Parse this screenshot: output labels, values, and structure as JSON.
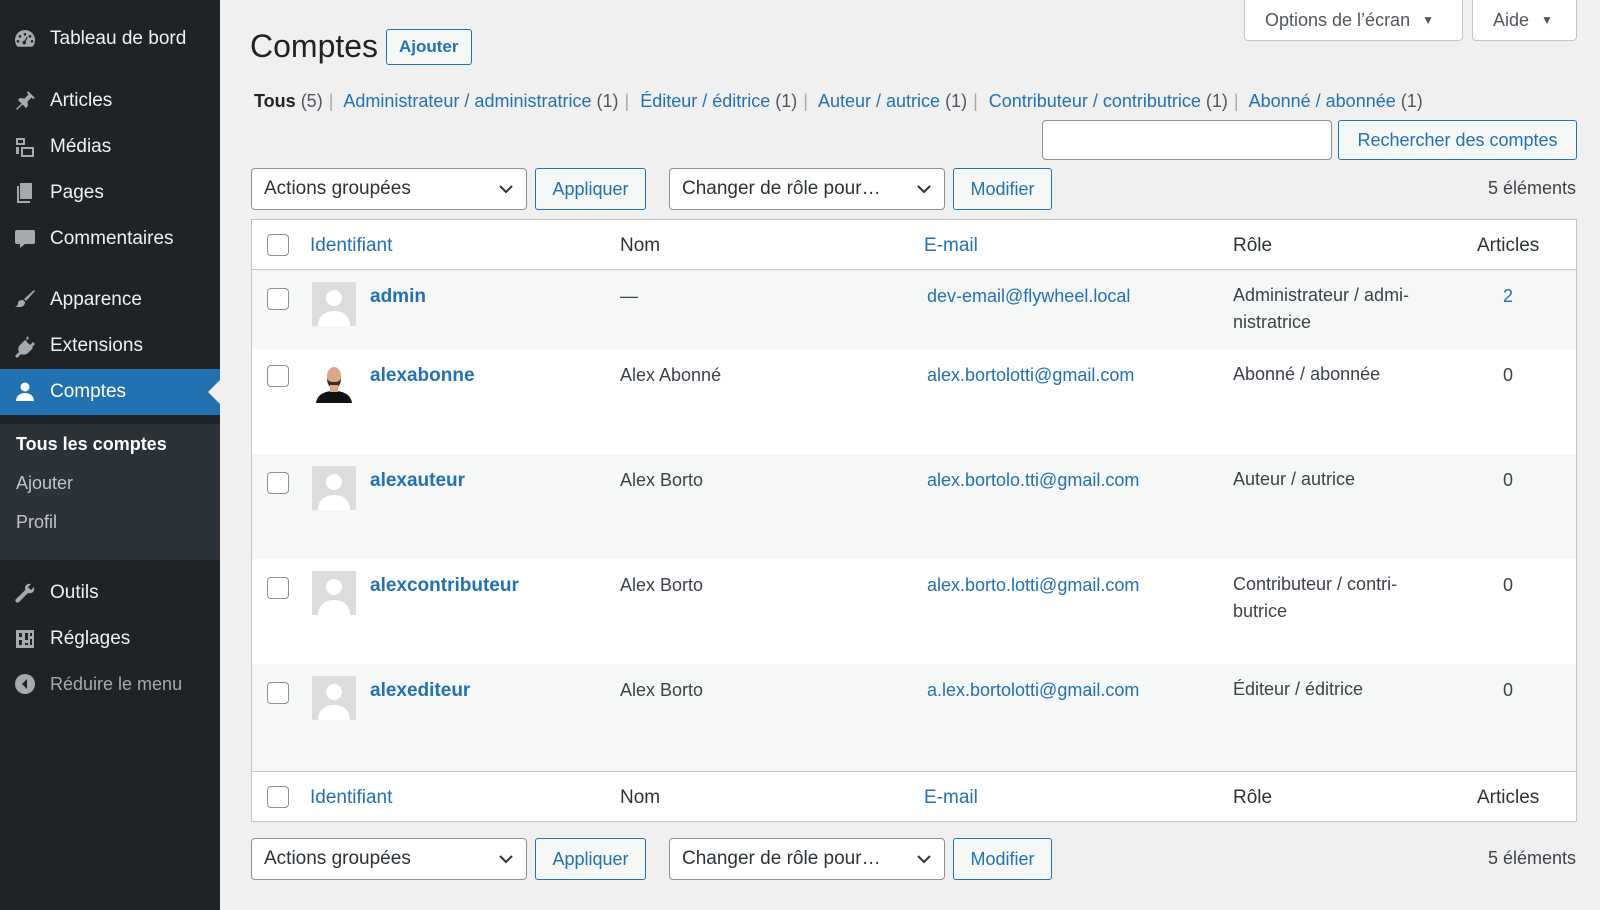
{
  "sidebar": {
    "items": [
      {
        "label": "Tableau de bord",
        "icon": "dashboard-icon"
      },
      {
        "label": "Articles",
        "icon": "pin-icon"
      },
      {
        "label": "Médias",
        "icon": "media-icon"
      },
      {
        "label": "Pages",
        "icon": "pages-icon"
      },
      {
        "label": "Commentaires",
        "icon": "comments-icon"
      },
      {
        "label": "Apparence",
        "icon": "appearance-brush-icon"
      },
      {
        "label": "Extensions",
        "icon": "plugins-icon"
      },
      {
        "label": "Comptes",
        "icon": "users-icon"
      },
      {
        "label": "Outils",
        "icon": "tools-wrench-icon"
      },
      {
        "label": "Réglages",
        "icon": "settings-sliders-icon"
      }
    ],
    "submenu": [
      "Tous les comptes",
      "Ajouter",
      "Profil"
    ],
    "collapse_label": "Réduire le menu"
  },
  "screen_options": {
    "label": "Options de l’écran",
    "help_label": "Aide"
  },
  "header": {
    "title": "Comptes",
    "add_label": "Ajouter"
  },
  "filters": [
    {
      "label": "Tous",
      "count": "(5)"
    },
    {
      "label": "Administrateur / administratrice",
      "count": "(1)"
    },
    {
      "label": "Éditeur / éditrice",
      "count": "(1)"
    },
    {
      "label": "Auteur / autrice",
      "count": "(1)"
    },
    {
      "label": "Contributeur / contributrice",
      "count": "(1)"
    },
    {
      "label": "Abonné / abonnée",
      "count": "(1)"
    }
  ],
  "search": {
    "value": "",
    "button_label": "Rechercher des comptes"
  },
  "tablenav": {
    "bulk_actions": "Actions groupées",
    "apply_label": "Appliquer",
    "change_role": "Changer de rôle pour…",
    "modify_label": "Modifier",
    "count": "5 éléments"
  },
  "table": {
    "columns": {
      "username": "Identifiant",
      "name": "Nom",
      "email": "E-mail",
      "role": "Rôle",
      "posts": "Articles"
    },
    "rows": [
      {
        "username": "admin",
        "name": "—",
        "email": "dev-email@flywheel.local",
        "role": "Administrateur / admi-nistratrice",
        "posts": "2",
        "avatar": "default"
      },
      {
        "username": "alexabonne",
        "name": "Alex Abonné",
        "email": "alex.bortolotti@gmail.com",
        "role": "Abonné / abonnée",
        "posts": "0",
        "avatar": "photo"
      },
      {
        "username": "alexauteur",
        "name": "Alex Borto",
        "email": "alex.bortolo.tti@gmail.com",
        "role": "Auteur / autrice",
        "posts": "0",
        "avatar": "default"
      },
      {
        "username": "alexcontributeur",
        "name": "Alex Borto",
        "email": "alex.borto.lotti@gmail.com",
        "role": "Contributeur / contri-butrice",
        "posts": "0",
        "avatar": "default"
      },
      {
        "username": "alexediteur",
        "name": "Alex Borto",
        "email": "a.lex.bortolotti@gmail.com",
        "role": "Éditeur / éditrice",
        "posts": "0",
        "avatar": "default"
      }
    ]
  },
  "colors": {
    "sidebar_bg": "#1d2327",
    "accent": "#2271b1",
    "page_bg": "#f0f0f1"
  }
}
